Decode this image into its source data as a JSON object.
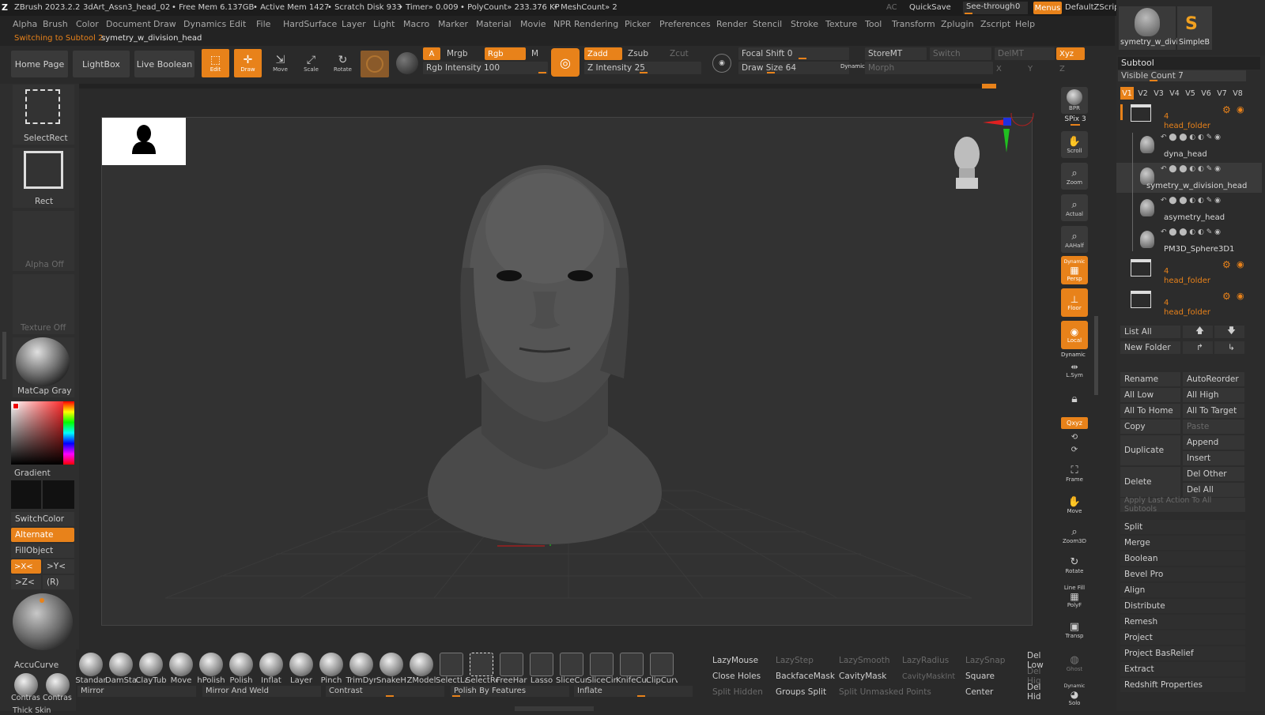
{
  "titlebar": {
    "app": "ZBrush 2023.2.2",
    "file": "3dArt_Assn3_head_02",
    "free_mem": "• Free Mem 6.137GB",
    "active_mem": "• Active Mem 1427",
    "scratch": "• Scratch Disk 933",
    "timer": "• Timer» 0.009",
    "polycount": "• PolyCount» 233.376 KP",
    "meshcount": "• MeshCount» 2",
    "ac": "AC",
    "quicksave": "QuickSave",
    "seethrough": "See-through",
    "seethrough_val": "0",
    "menus": "Menus",
    "script": "DefaultZScript"
  },
  "menubar": [
    "Alpha",
    "Brush",
    "Color",
    "Document",
    "Draw",
    "Dynamics",
    "Edit",
    "File",
    "HardSurface",
    "Layer",
    "Light",
    "Macro",
    "Marker",
    "Material",
    "Movie",
    "NPR Rendering",
    "Picker",
    "Preferences",
    "Render",
    "Stencil",
    "Stroke",
    "Texture",
    "Tool",
    "Transform",
    "Zplugin",
    "Zscript",
    "Help"
  ],
  "note": {
    "prefix": "Switching to Subtool 2:",
    "name": "symetry_w_division_head"
  },
  "toolbar": {
    "home": "Home Page",
    "lightbox": "LightBox",
    "liveboolean": "Live Boolean",
    "edit": "Edit",
    "draw": "Draw",
    "move": "Move",
    "scale": "Scale",
    "rotate": "Rotate",
    "a": "A",
    "mrgb": "Mrgb",
    "rgb": "Rgb",
    "m": "M",
    "rgb_intensity": "Rgb Intensity 100",
    "zadd": "Zadd",
    "zsub": "Zsub",
    "zcut": "Zcut",
    "z_intensity": "Z Intensity 25",
    "focal": "Focal Shift 0",
    "drawsize": "Draw Size 64",
    "dynamic": "Dynamic",
    "storemt": "StoreMT",
    "switch": "Switch",
    "delmt": "DelMT",
    "morph": "Morph",
    "xyz": "Xyz",
    "x": "X",
    "y": "Y",
    "z": "Z"
  },
  "tooltop": {
    "name1": "symetry_w_divisi",
    "name2": "SimpleB"
  },
  "left": {
    "selectrect": "SelectRect",
    "rect": "Rect",
    "alphaoff": "Alpha Off",
    "textureoff": "Texture Off",
    "matcap": "MatCap Gray",
    "gradient": "Gradient",
    "switchcolor": "SwitchColor",
    "alternate": "Alternate",
    "fillobject": "FillObject",
    "xsym": ">X<",
    "ysym": ">Y<",
    "zsym": ">Z<",
    "r": "(R)",
    "accucurve": "AccuCurve",
    "contrast1": "Contras",
    "contrast2": "Contras",
    "thickskin": "Thick Skin"
  },
  "rightnav": {
    "bpr": "BPR",
    "spix": "SPix 3",
    "scroll": "Scroll",
    "zoom": "Zoom",
    "actual": "Actual",
    "aahalf": "AAHalf",
    "dynamic": "Dynamic",
    "persp": "Persp",
    "floor": "Floor",
    "local": "Local",
    "dynamic2": "Dynamic",
    "lsym": "L.Sym",
    "xyz": "Qxyz",
    "frame": "Frame",
    "move": "Move",
    "zoom3d": "Zoom3D",
    "rotate": "Rotate",
    "linefill": "Line Fill",
    "polyf": "PolyF",
    "transp": "Transp",
    "ghost": "Ghost",
    "dynamic3": "Dynamic",
    "solo": "Solo"
  },
  "subtool": {
    "title": "Subtool",
    "visible": "Visible Count 7",
    "versions": [
      "V1",
      "V2",
      "V3",
      "V4",
      "V5",
      "V6",
      "V7",
      "V8"
    ],
    "items": [
      {
        "label": "head_folder",
        "count": "4",
        "type": "folder"
      },
      {
        "label": "dyna_head",
        "type": "mesh"
      },
      {
        "label": "symetry_w_division_head",
        "type": "mesh"
      },
      {
        "label": "asymetry_head",
        "type": "mesh"
      },
      {
        "label": "PM3D_Sphere3D1",
        "type": "mesh"
      },
      {
        "label": "head_folder",
        "count": "4",
        "type": "folder"
      },
      {
        "label": "head_folder",
        "count": "4",
        "type": "folder"
      }
    ],
    "listall": "List All",
    "newfolder": "New Folder",
    "rename": "Rename",
    "autoreorder": "AutoReorder",
    "alllow": "All Low",
    "allhigh": "All High",
    "alltohome": "All To Home",
    "alltotarget": "All To Target",
    "copy": "Copy",
    "paste": "Paste",
    "duplicate": "Duplicate",
    "append": "Append",
    "insert": "Insert",
    "delete": "Delete",
    "delother": "Del Other",
    "delall": "Del All",
    "applylast": "Apply Last Action To All Subtools",
    "bottom": [
      "Split",
      "Merge",
      "Boolean",
      "Bevel Pro",
      "Align",
      "Distribute",
      "Remesh",
      "Project",
      "Project BasRelief",
      "Extract",
      "Redshift Properties"
    ]
  },
  "brushes": [
    "Standar",
    "DamSta",
    "ClayTub",
    "Move",
    "hPolish",
    "Polish",
    "Inflat",
    "Layer",
    "Pinch",
    "TrimDyr",
    "SnakeH",
    "ZModel",
    "SelectLa",
    "SelectRe",
    "FreeHar",
    "Lasso",
    "SliceCur",
    "SliceCir",
    "KnifeCur",
    "ClipCurv"
  ],
  "bottombar": {
    "mirror": "Mirror",
    "mirrorweld": "Mirror And Weld",
    "contrast": "Contrast",
    "polishfeat": "Polish By Features",
    "inflate": "Inflate",
    "lazymouse": "LazyMouse",
    "lazystep": "LazyStep",
    "lazysmooth": "LazySmooth",
    "lazyradius": "LazyRadius",
    "lazysnap": "LazySnap",
    "dellow": "Del Low",
    "closeholes": "Close Holes",
    "backfacemask": "BackfaceMask",
    "cavitymask": "CavityMask",
    "cavitymaskint": "CavityMaskInt",
    "square": "Square",
    "delhigh": "Del Hig",
    "splithidden": "Split Hidden",
    "groupssplit": "Groups Split",
    "splitunmasked": "Split Unmasked Points",
    "center": "Center",
    "delhid": "Del Hid"
  },
  "colors": {
    "accent": "#e8821a",
    "bg": "#2a2a2a",
    "panel": "#2e2e2e",
    "button": "#3a3a3a",
    "canvas": "#303030"
  }
}
